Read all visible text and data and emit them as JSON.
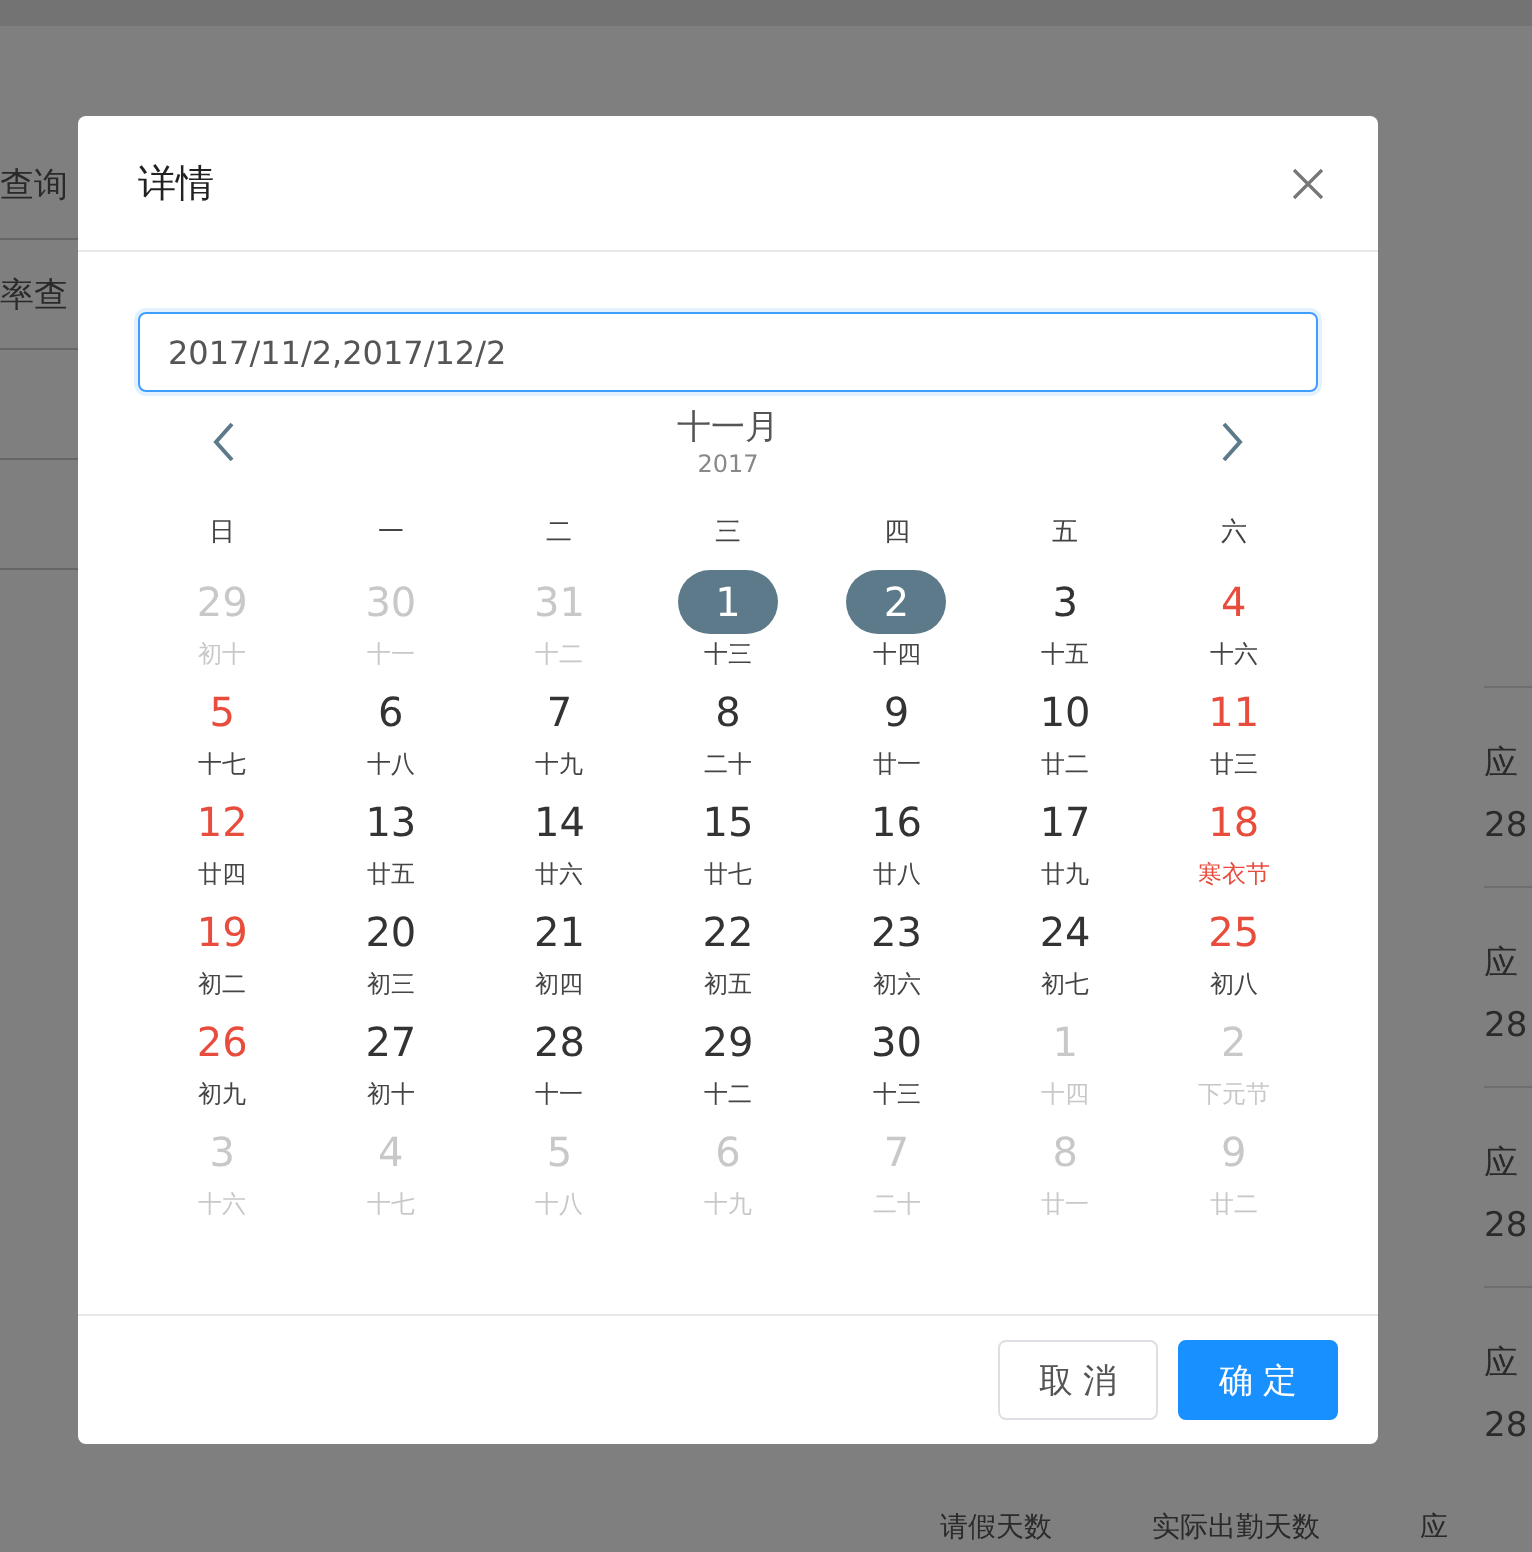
{
  "background": {
    "left_labels": [
      "查询",
      "率查"
    ],
    "right_rows": [
      {
        "label": "应",
        "value": "28"
      },
      {
        "label": "应",
        "value": "28"
      },
      {
        "label": "应",
        "value": "28"
      },
      {
        "label": "应",
        "value": "28"
      }
    ],
    "bottom_labels": [
      "请假天数",
      "实际出勤天数",
      "应"
    ]
  },
  "dialog": {
    "title": "详情",
    "date_input": {
      "value": "2017/11/2,2017/12/2"
    },
    "calendar": {
      "month": "十一月",
      "year": "2017",
      "weekdays": [
        "日",
        "一",
        "二",
        "三",
        "四",
        "五",
        "六"
      ],
      "days": [
        {
          "day": "29",
          "lunar": "初十",
          "muted": true,
          "weekend": false,
          "festival": false,
          "selected": false
        },
        {
          "day": "30",
          "lunar": "十一",
          "muted": true,
          "weekend": false,
          "festival": false,
          "selected": false
        },
        {
          "day": "31",
          "lunar": "十二",
          "muted": true,
          "weekend": false,
          "festival": false,
          "selected": false
        },
        {
          "day": "1",
          "lunar": "十三",
          "muted": false,
          "weekend": false,
          "festival": false,
          "selected": true
        },
        {
          "day": "2",
          "lunar": "十四",
          "muted": false,
          "weekend": false,
          "festival": false,
          "selected": true
        },
        {
          "day": "3",
          "lunar": "十五",
          "muted": false,
          "weekend": false,
          "festival": false,
          "selected": false
        },
        {
          "day": "4",
          "lunar": "十六",
          "muted": false,
          "weekend": true,
          "festival": false,
          "selected": false
        },
        {
          "day": "5",
          "lunar": "十七",
          "muted": false,
          "weekend": true,
          "festival": false,
          "selected": false
        },
        {
          "day": "6",
          "lunar": "十八",
          "muted": false,
          "weekend": false,
          "festival": false,
          "selected": false
        },
        {
          "day": "7",
          "lunar": "十九",
          "muted": false,
          "weekend": false,
          "festival": false,
          "selected": false
        },
        {
          "day": "8",
          "lunar": "二十",
          "muted": false,
          "weekend": false,
          "festival": false,
          "selected": false
        },
        {
          "day": "9",
          "lunar": "廿一",
          "muted": false,
          "weekend": false,
          "festival": false,
          "selected": false
        },
        {
          "day": "10",
          "lunar": "廿二",
          "muted": false,
          "weekend": false,
          "festival": false,
          "selected": false
        },
        {
          "day": "11",
          "lunar": "廿三",
          "muted": false,
          "weekend": true,
          "festival": false,
          "selected": false
        },
        {
          "day": "12",
          "lunar": "廿四",
          "muted": false,
          "weekend": true,
          "festival": false,
          "selected": false
        },
        {
          "day": "13",
          "lunar": "廿五",
          "muted": false,
          "weekend": false,
          "festival": false,
          "selected": false
        },
        {
          "day": "14",
          "lunar": "廿六",
          "muted": false,
          "weekend": false,
          "festival": false,
          "selected": false
        },
        {
          "day": "15",
          "lunar": "廿七",
          "muted": false,
          "weekend": false,
          "festival": false,
          "selected": false
        },
        {
          "day": "16",
          "lunar": "廿八",
          "muted": false,
          "weekend": false,
          "festival": false,
          "selected": false
        },
        {
          "day": "17",
          "lunar": "廿九",
          "muted": false,
          "weekend": false,
          "festival": false,
          "selected": false
        },
        {
          "day": "18",
          "lunar": "寒衣节",
          "muted": false,
          "weekend": true,
          "festival": true,
          "selected": false
        },
        {
          "day": "19",
          "lunar": "初二",
          "muted": false,
          "weekend": true,
          "festival": false,
          "selected": false
        },
        {
          "day": "20",
          "lunar": "初三",
          "muted": false,
          "weekend": false,
          "festival": false,
          "selected": false
        },
        {
          "day": "21",
          "lunar": "初四",
          "muted": false,
          "weekend": false,
          "festival": false,
          "selected": false
        },
        {
          "day": "22",
          "lunar": "初五",
          "muted": false,
          "weekend": false,
          "festival": false,
          "selected": false
        },
        {
          "day": "23",
          "lunar": "初六",
          "muted": false,
          "weekend": false,
          "festival": false,
          "selected": false
        },
        {
          "day": "24",
          "lunar": "初七",
          "muted": false,
          "weekend": false,
          "festival": false,
          "selected": false
        },
        {
          "day": "25",
          "lunar": "初八",
          "muted": false,
          "weekend": true,
          "festival": false,
          "selected": false
        },
        {
          "day": "26",
          "lunar": "初九",
          "muted": false,
          "weekend": true,
          "festival": false,
          "selected": false
        },
        {
          "day": "27",
          "lunar": "初十",
          "muted": false,
          "weekend": false,
          "festival": false,
          "selected": false
        },
        {
          "day": "28",
          "lunar": "十一",
          "muted": false,
          "weekend": false,
          "festival": false,
          "selected": false
        },
        {
          "day": "29",
          "lunar": "十二",
          "muted": false,
          "weekend": false,
          "festival": false,
          "selected": false
        },
        {
          "day": "30",
          "lunar": "十三",
          "muted": false,
          "weekend": false,
          "festival": false,
          "selected": false
        },
        {
          "day": "1",
          "lunar": "十四",
          "muted": true,
          "weekend": false,
          "festival": false,
          "selected": false
        },
        {
          "day": "2",
          "lunar": "下元节",
          "muted": true,
          "weekend": false,
          "festival": false,
          "selected": false
        },
        {
          "day": "3",
          "lunar": "十六",
          "muted": true,
          "weekend": false,
          "festival": false,
          "selected": false
        },
        {
          "day": "4",
          "lunar": "十七",
          "muted": true,
          "weekend": false,
          "festival": false,
          "selected": false
        },
        {
          "day": "5",
          "lunar": "十八",
          "muted": true,
          "weekend": false,
          "festival": false,
          "selected": false
        },
        {
          "day": "6",
          "lunar": "十九",
          "muted": true,
          "weekend": false,
          "festival": false,
          "selected": false
        },
        {
          "day": "7",
          "lunar": "二十",
          "muted": true,
          "weekend": false,
          "festival": false,
          "selected": false
        },
        {
          "day": "8",
          "lunar": "廿一",
          "muted": true,
          "weekend": false,
          "festival": false,
          "selected": false
        },
        {
          "day": "9",
          "lunar": "廿二",
          "muted": true,
          "weekend": false,
          "festival": false,
          "selected": false
        }
      ]
    },
    "buttons": [
      {
        "label": "取 消",
        "kind": "default"
      },
      {
        "label": "确 定",
        "kind": "primary"
      }
    ]
  }
}
